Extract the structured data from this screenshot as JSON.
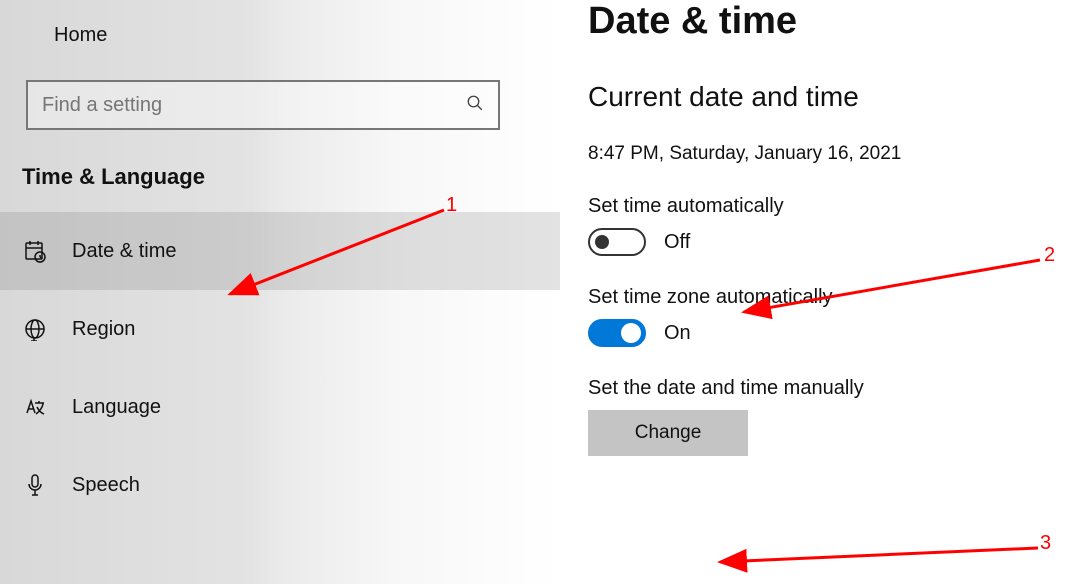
{
  "sidebar": {
    "home_label": "Home",
    "search_placeholder": "Find a setting",
    "category": "Time & Language",
    "items": [
      {
        "label": "Date & time",
        "selected": true
      },
      {
        "label": "Region",
        "selected": false
      },
      {
        "label": "Language",
        "selected": false
      },
      {
        "label": "Speech",
        "selected": false
      }
    ]
  },
  "main": {
    "title": "Date & time",
    "section_title": "Current date and time",
    "current_datetime": "8:47 PM, Saturday, January 16, 2021",
    "set_time_auto_label": "Set time automatically",
    "set_time_auto_state": "Off",
    "set_tz_auto_label": "Set time zone automatically",
    "set_tz_auto_state": "On",
    "set_manual_label": "Set the date and time manually",
    "change_button": "Change"
  },
  "annotations": {
    "one": "1",
    "two": "2",
    "three": "3"
  }
}
